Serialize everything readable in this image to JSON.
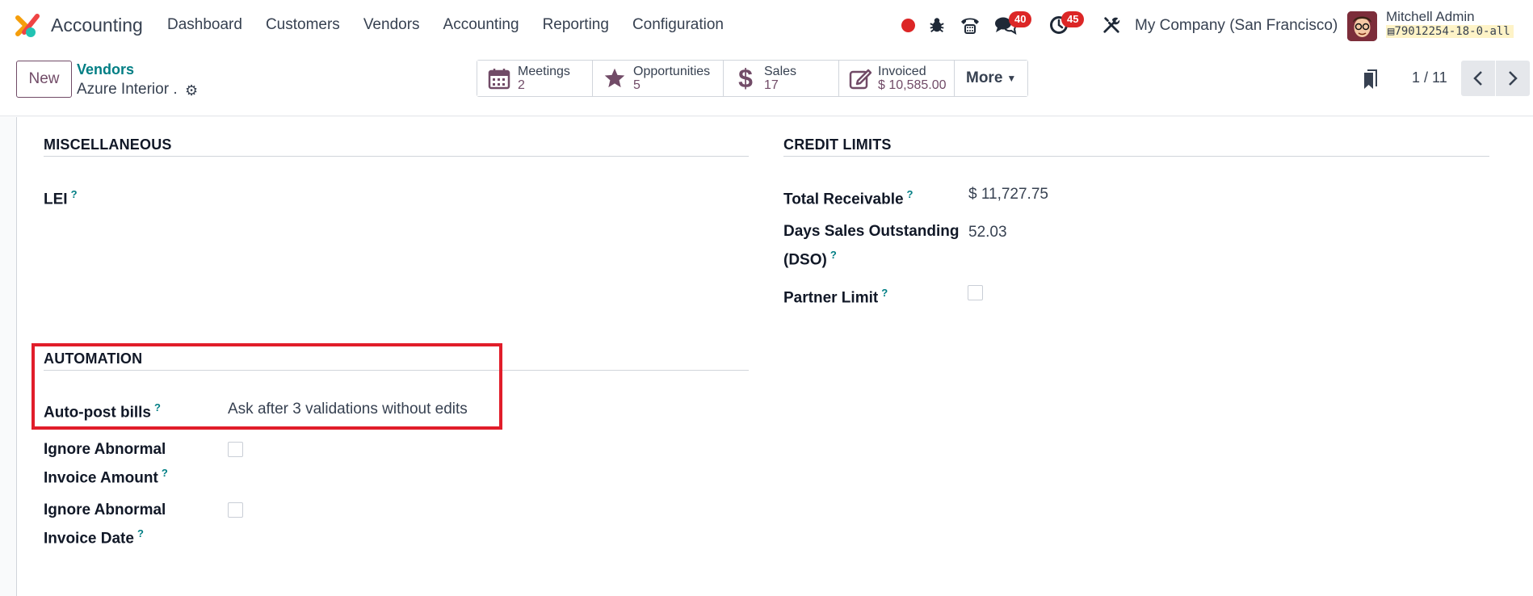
{
  "navbar": {
    "app_name": "Accounting",
    "menu": [
      "Dashboard",
      "Customers",
      "Vendors",
      "Accounting",
      "Reporting",
      "Configuration"
    ],
    "chat_badge": "40",
    "activity_badge": "45",
    "company": "My Company (San Francisco)",
    "user_name": "Mitchell Admin",
    "db_name": "79012254-18-0-all"
  },
  "control_panel": {
    "new_label": "New",
    "breadcrumb": "Vendors",
    "record_name": "Azure Interior .",
    "smart_buttons": [
      {
        "label": "Meetings",
        "value": "2",
        "icon": "calendar-icon"
      },
      {
        "label": "Opportunities",
        "value": "5",
        "icon": "star-icon"
      },
      {
        "label": "Sales",
        "value": "17",
        "icon": "dollar-icon"
      },
      {
        "label": "Invoiced",
        "value": "$ 10,585.00",
        "icon": "edit-icon"
      }
    ],
    "more_label": "More",
    "pager": "1 / 11"
  },
  "form": {
    "misc": {
      "title": "MISCELLANEOUS",
      "lei_label": "LEI"
    },
    "credit": {
      "title": "CREDIT LIMITS",
      "total_receivable_label": "Total Receivable",
      "total_receivable_value": "$ 11,727.75",
      "dso_label_1": "Days Sales Outstanding",
      "dso_label_2": "(DSO)",
      "dso_value": "52.03",
      "partner_limit_label": "Partner Limit"
    },
    "automation": {
      "title": "AUTOMATION",
      "autopost_label": "Auto-post bills",
      "autopost_value": "Ask after 3 validations without edits",
      "ignore_amount_label_1": "Ignore Abnormal",
      "ignore_amount_label_2": "Invoice Amount",
      "ignore_date_label_1": "Ignore Abnormal",
      "ignore_date_label_2": "Invoice Date"
    },
    "help_mark": "?"
  },
  "colors": {
    "brand": "#714b67",
    "link": "#017e84",
    "badge": "#dc2626",
    "highlight": "#e11d2a"
  }
}
